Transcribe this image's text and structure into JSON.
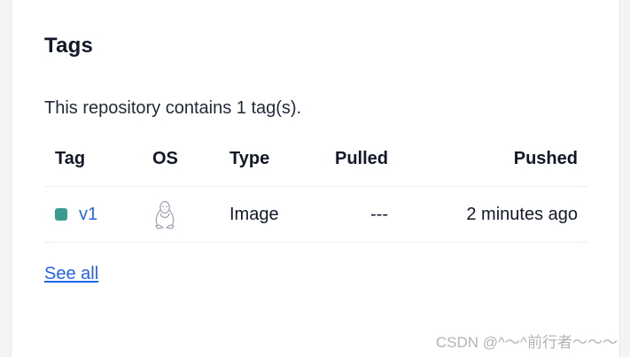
{
  "section": {
    "title": "Tags",
    "summary": "This repository contains 1 tag(s).",
    "see_all_label": "See all"
  },
  "table": {
    "headers": {
      "tag": "Tag",
      "os": "OS",
      "type": "Type",
      "pulled": "Pulled",
      "pushed": "Pushed"
    },
    "rows": [
      {
        "tag": "v1",
        "status_color": "#3a9b8f",
        "os_icon": "linux-tux-icon",
        "type": "Image",
        "pulled": "---",
        "pushed": "2 minutes ago"
      }
    ]
  },
  "watermark": "CSDN @^～^前行者～～～",
  "colors": {
    "link": "#2563eb",
    "status_dot": "#3a9b8f"
  }
}
